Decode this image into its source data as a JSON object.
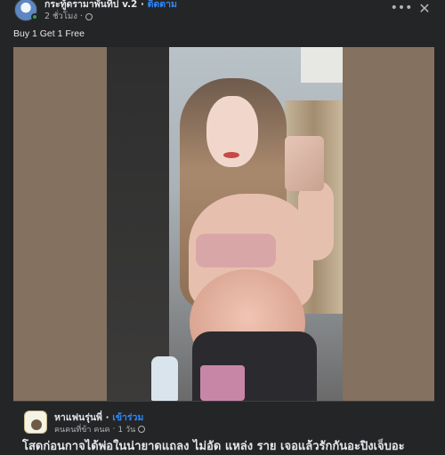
{
  "header": {
    "page_name": "กระทู้ดรามาพันทิป v.2",
    "separator": " · ",
    "follow_label": "ติดตาม",
    "time": "2 ชั่วโมง",
    "dot": "·",
    "privacy_icon": "globe-icon"
  },
  "actions": {
    "more_label": "•••",
    "close_label": "✕"
  },
  "post": {
    "caption": "Buy 1 Get 1 Free"
  },
  "shared": {
    "name": "หาแฟนรุ่นพี่",
    "separator": " · ",
    "join_label": "เข้าร่วม",
    "author": "คนคนที่ข้า คนค",
    "dot": "·",
    "time": "1 วัน",
    "text": "โสดก่อนกาจได้พ่อในน่ายาดแถลง ไม่อัด แหล่ง ราย เจอแล้วรักกันอะปิงเจ็บอะ"
  },
  "colors": {
    "background": "#242526",
    "text_primary": "#e4e6eb",
    "text_secondary": "#b0b3b8",
    "link": "#2d88ff",
    "media_backdrop": "#84715f"
  }
}
